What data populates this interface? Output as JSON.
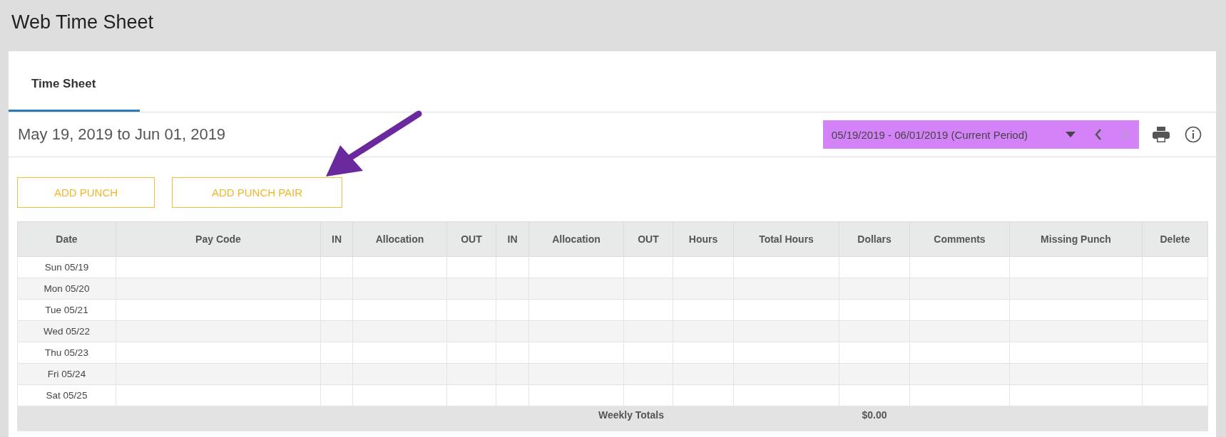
{
  "page_title": "Web Time Sheet",
  "tabs": [
    {
      "label": "Time Sheet",
      "selected": true
    }
  ],
  "period": {
    "range_title": "May 19, 2019 to Jun 01, 2019",
    "selector": "05/19/2019 - 06/01/2019 (Current Period)",
    "highlighted": true,
    "prev_disabled": false,
    "next_disabled": true
  },
  "buttons": [
    "ADD PUNCH",
    "ADD PUNCH PAIR"
  ],
  "table": {
    "columns": [
      "Date",
      "Pay Code",
      "IN",
      "Allocation",
      "OUT",
      "IN",
      "Allocation",
      "OUT",
      "Hours",
      "Total Hours",
      "Dollars",
      "Comments",
      "Missing Punch",
      "Delete"
    ],
    "rows": [
      "Sun 05/19",
      "Mon 05/20",
      "Tue 05/21",
      "Wed 05/22",
      "Thu 05/23",
      "Fri 05/24",
      "Sat 05/25"
    ],
    "totals": {
      "label": "Weekly Totals",
      "dollars": "$0.00"
    }
  }
}
